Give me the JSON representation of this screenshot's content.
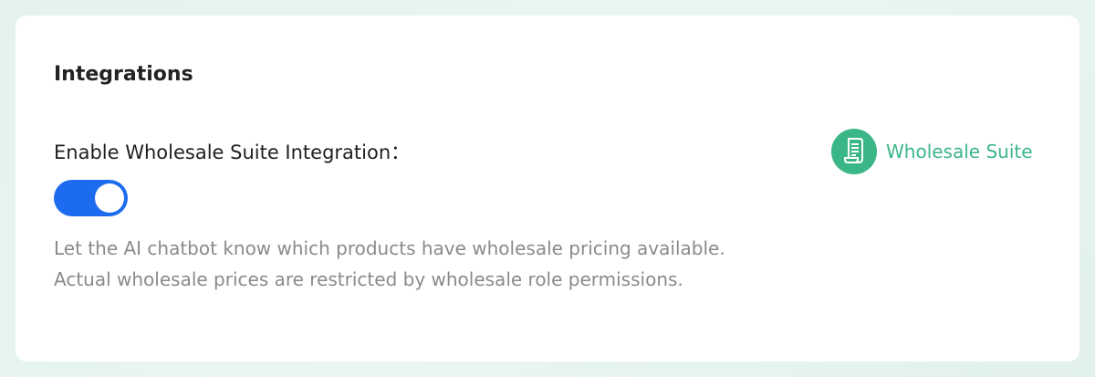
{
  "section": {
    "title": "Integrations"
  },
  "wholesale_setting": {
    "label": "Enable Wholesale Suite Integration：",
    "toggle_on": true,
    "description": "Let the AI chatbot know which products have wholesale pricing available. Actual wholesale prices are restricted by wholesale role permissions."
  },
  "brand": {
    "name": "Wholesale Suite",
    "icon": "receipt-scroll-icon",
    "color": "#3bb687"
  },
  "colors": {
    "toggle_accent": "#1d6cf0",
    "description_text": "#8a8a8a"
  }
}
